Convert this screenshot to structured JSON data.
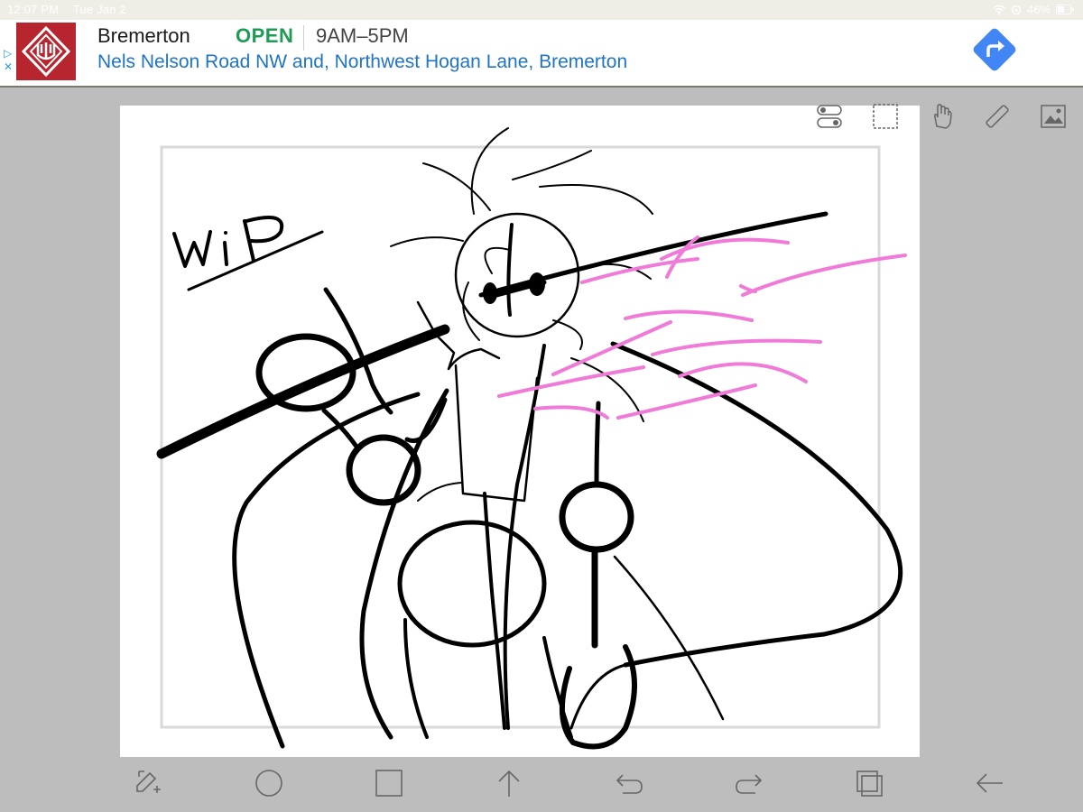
{
  "status_bar": {
    "time": "12:07 PM",
    "date": "Tue Jan 2",
    "battery": "46%"
  },
  "ad": {
    "business_name": "Bremerton",
    "status": "OPEN",
    "hours": "9AM–5PM",
    "address": "Nels Nelson Road NW and, Northwest Hogan Lane, Bremerton",
    "brand_color": "#b7262e",
    "directions_color": "#4285f4"
  },
  "canvas": {
    "drawing_text": "WiP",
    "stroke_color": "#000000",
    "accent_color": "#f07ad8"
  },
  "side_tools": [
    "layers-toggle-icon",
    "selection-icon",
    "hand-icon",
    "ruler-icon",
    "image-icon"
  ],
  "bottom_tools": [
    "transform-icon",
    "circle-shape-icon",
    "square-shape-icon",
    "upload-arrow-icon",
    "undo-icon",
    "redo-icon",
    "layers-icon",
    "back-arrow-icon"
  ]
}
